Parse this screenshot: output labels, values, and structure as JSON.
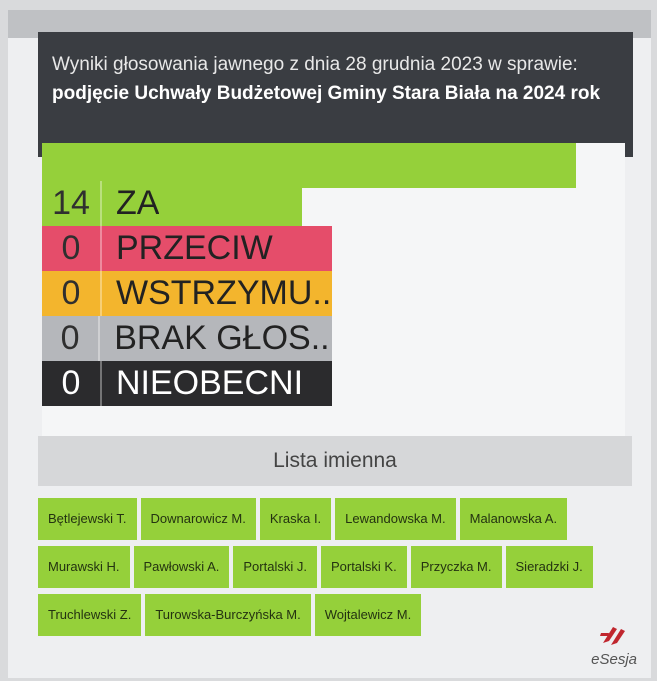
{
  "header": {
    "prefix": "Wyniki głosowania jawnego z dnia 28 grudnia 2023 w sprawie: ",
    "subject": "podjęcie Uchwały Budżetowej Gminy Stara Biała na 2024 rok"
  },
  "results": [
    {
      "count": "14",
      "label": "ZA",
      "color": "#95d03a"
    },
    {
      "count": "0",
      "label": "PRZECIW",
      "color": "#e54d6a"
    },
    {
      "count": "0",
      "label": "WSTRZYMU..",
      "color": "#f3b52d"
    },
    {
      "count": "0",
      "label": "BRAK GŁOS...",
      "color": "#b5b7bb"
    },
    {
      "count": "0",
      "label": "NIEOBECNI",
      "color": "#2b2b2d"
    }
  ],
  "list_title": "Lista imienna",
  "names": [
    "Bętlejewski T.",
    "Downarowicz M.",
    "Kraska I.",
    "Lewandowska M.",
    "Malanowska A.",
    "Murawski H.",
    "Pawłowski A.",
    "Portalski J.",
    "Portalski K.",
    "Przyczka M.",
    "Sieradzki J.",
    "Truchlewski Z.",
    "Turowska-Burczyńska M.",
    "Wojtalewicz M."
  ],
  "logo": {
    "text": "eSesja",
    "icon": "esesja-logo-icon"
  }
}
